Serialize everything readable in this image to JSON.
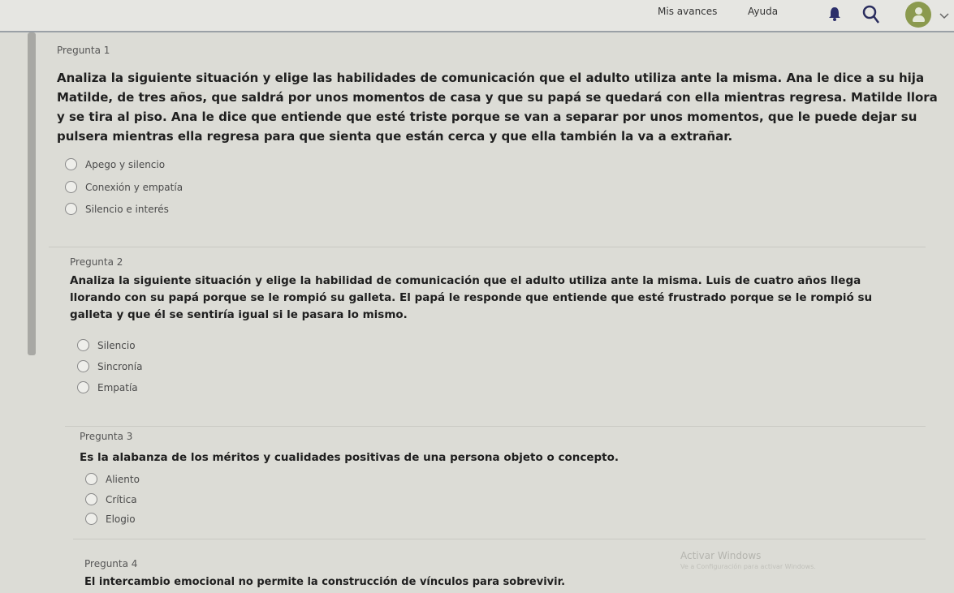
{
  "header": {
    "links": [
      "Mis avances",
      "Ayuda"
    ],
    "icons": [
      "bell-icon",
      "search-icon",
      "avatar",
      "chevron-down-icon"
    ]
  },
  "questions": [
    {
      "number": "Pregunta 1",
      "text": "Analiza la siguiente situación y elige las habilidades de comunicación que el adulto utiliza ante la misma. Ana le dice a su hija Matilde, de tres años, que saldrá por unos momentos de casa y que su papá se quedará con ella mientras regresa. Matilde llora y se tira al piso. Ana le dice que entiende que esté triste porque se van a separar por unos momentos, que le puede dejar su pulsera mientras ella regresa para que sienta que están cerca y que ella también la va a extrañar.",
      "options": [
        "Apego y silencio",
        "Conexión y empatía",
        "Silencio e interés"
      ]
    },
    {
      "number": "Pregunta 2",
      "text": "Analiza la siguiente situación y elige la habilidad de comunicación que el adulto utiliza ante la misma. Luis de cuatro años llega llorando con su papá porque se le rompió su galleta. El papá le responde que entiende que esté frustrado porque se le rompió su galleta y que él se sentiría igual si le pasara lo mismo.",
      "options": [
        "Silencio",
        "Sincronía",
        "Empatía"
      ]
    },
    {
      "number": "Pregunta 3",
      "text": "Es la alabanza de los méritos y cualidades positivas de una persona objeto o concepto.",
      "options": [
        "Aliento",
        "Crítica",
        "Elogio"
      ]
    },
    {
      "number": "Pregunta 4",
      "text": "El intercambio emocional no permite la construcción de vínculos para sobrevivir."
    }
  ],
  "watermark": {
    "title": "Activar Windows",
    "subtitle": "Ve a Configuración para activar Windows."
  }
}
